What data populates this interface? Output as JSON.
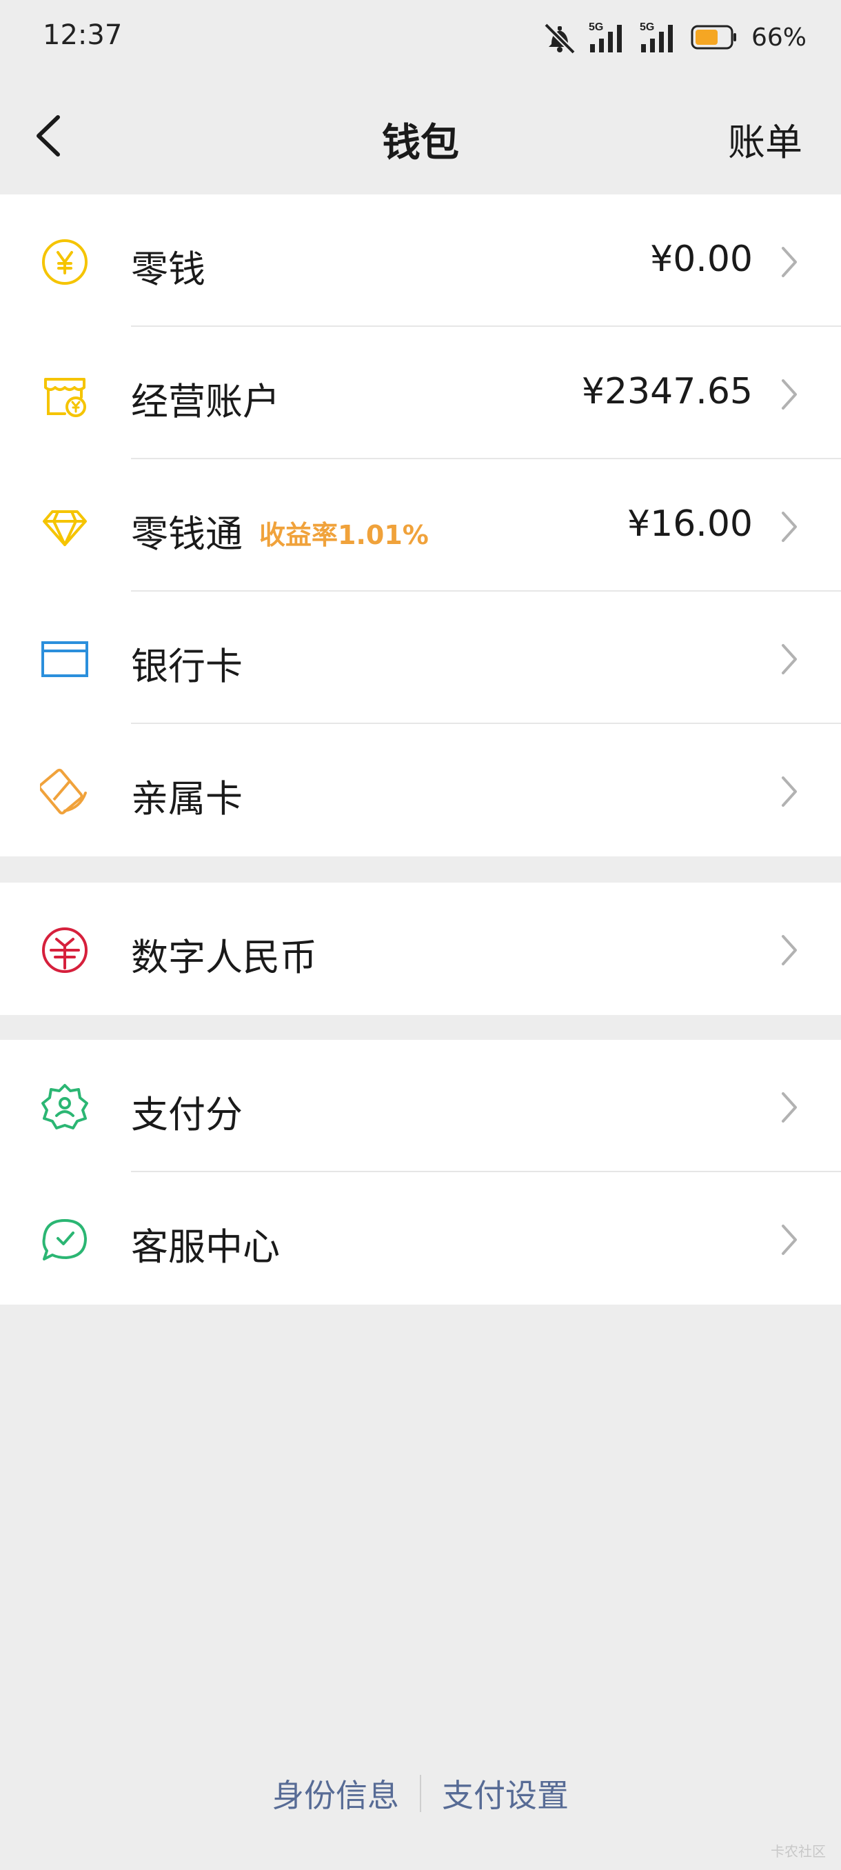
{
  "status_bar": {
    "time": "12:37",
    "signal_1_label": "5G",
    "signal_2_label": "5G",
    "battery_percent": "66%",
    "battery_color": "#f5a623",
    "icons": [
      "bell-mute-icon",
      "signal-icon",
      "signal-icon",
      "battery-icon"
    ]
  },
  "nav": {
    "title": "钱包",
    "right_action": "账单",
    "back_icon": "chevron-left-icon"
  },
  "groups": [
    {
      "items": [
        {
          "id": "change",
          "label": "零钱",
          "value": "¥0.00",
          "icon": "yuan-coin-icon",
          "icon_color": "#f5c400"
        },
        {
          "id": "business-account",
          "label": "经营账户",
          "value": "¥2347.65",
          "icon": "shop-icon",
          "icon_color": "#f5c400"
        },
        {
          "id": "lingqiantong",
          "label": "零钱通",
          "tag": "收益率1.01%",
          "value": "¥16.00",
          "icon": "diamond-icon",
          "icon_color": "#f5c400"
        },
        {
          "id": "bank-card",
          "label": "银行卡",
          "value": "",
          "icon": "card-icon",
          "icon_color": "#2b8fdc"
        },
        {
          "id": "family-card",
          "label": "亲属卡",
          "value": "",
          "icon": "family-card-icon",
          "icon_color": "#f0a23b"
        }
      ]
    },
    {
      "items": [
        {
          "id": "digital-rmb",
          "label": "数字人民币",
          "value": "",
          "icon": "ecny-icon",
          "icon_color": "#d6203c"
        }
      ]
    },
    {
      "items": [
        {
          "id": "pay-score",
          "label": "支付分",
          "value": "",
          "icon": "badge-user-icon",
          "icon_color": "#2bb673"
        },
        {
          "id": "customer-service",
          "label": "客服中心",
          "value": "",
          "icon": "chat-check-icon",
          "icon_color": "#2bb673"
        }
      ]
    }
  ],
  "footer": {
    "link_identity": "身份信息",
    "link_settings": "支付设置",
    "link_color": "#576b95"
  },
  "watermark": "卡农社区"
}
